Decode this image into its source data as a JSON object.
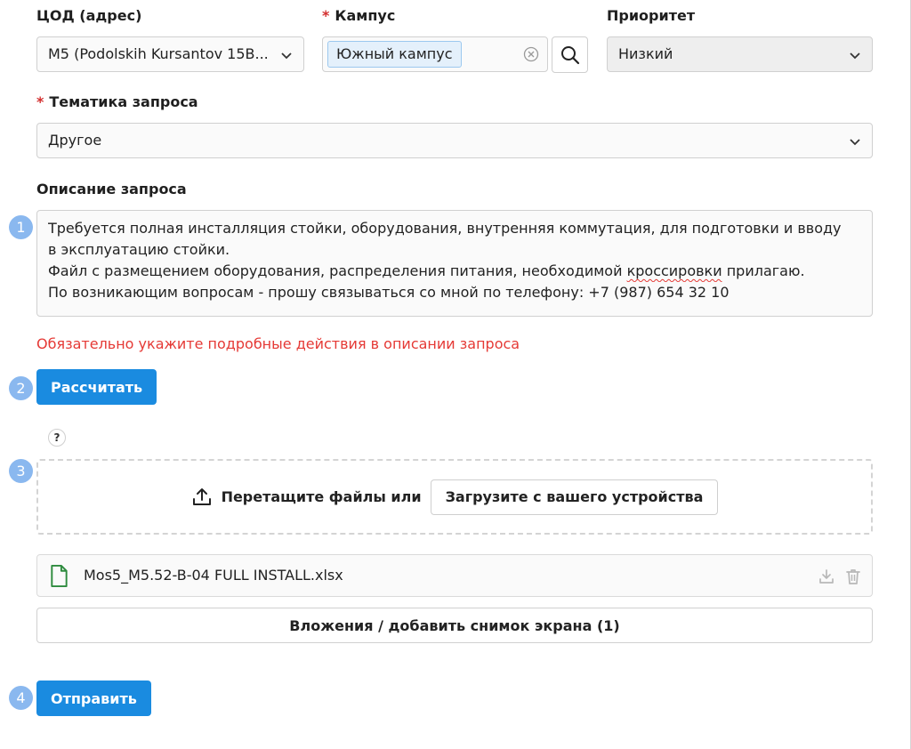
{
  "fields": {
    "datacenter": {
      "label": "ЦОД (адрес)",
      "value": "M5 (Podolskih Kursantov 15B..."
    },
    "campus": {
      "required_mark": "*",
      "label": "Кампус",
      "tag": "Южный кампус"
    },
    "priority": {
      "label": "Приоритет",
      "value": "Низкий"
    },
    "topic": {
      "required_mark": "*",
      "label": "Тематика запроса",
      "value": "Другое"
    },
    "description": {
      "label": "Описание запроса",
      "lines": [
        "Требуется полная инсталляция стойки, оборудования, внутренняя коммутация, для подготовки и вводу",
        "в эксплуатацию стойки.",
        "По возникающим вопросам - прошу связываться со мной по телефону: +7 (987) 654 32 10"
      ],
      "line3": {
        "before": "Файл с размещением оборудования, распределения питания, необходимой ",
        "misspelled": "кроссировки",
        "after": " прилагаю."
      },
      "spellcheck_flag": true
    }
  },
  "warning": "Обязательно укажите подробные действия в описании запроса",
  "calculate_label": "Рассчитать",
  "help_label": "?",
  "upload": {
    "icon": "upload-icon",
    "drop_text": "Перетащите файлы или",
    "button_label": "Загрузите с вашего устройства"
  },
  "file": {
    "icon": "file-icon",
    "name": "Mos5_M5.52-B-04 FULL INSTALL.xlsx",
    "actions": [
      "download-icon",
      "trash-icon"
    ]
  },
  "attachments_label": "Вложения / добавить снимок экрана (1)",
  "submit_label": "Отправить",
  "steps": [
    "1",
    "2",
    "3",
    "4"
  ],
  "colors": {
    "primary": "#1a8be0",
    "required": "#d32f2f",
    "warning": "#e53935",
    "step_marker": "#8ab8ef",
    "tag_background": "#e4f0fb",
    "file_icon": "#2e8b3e"
  }
}
